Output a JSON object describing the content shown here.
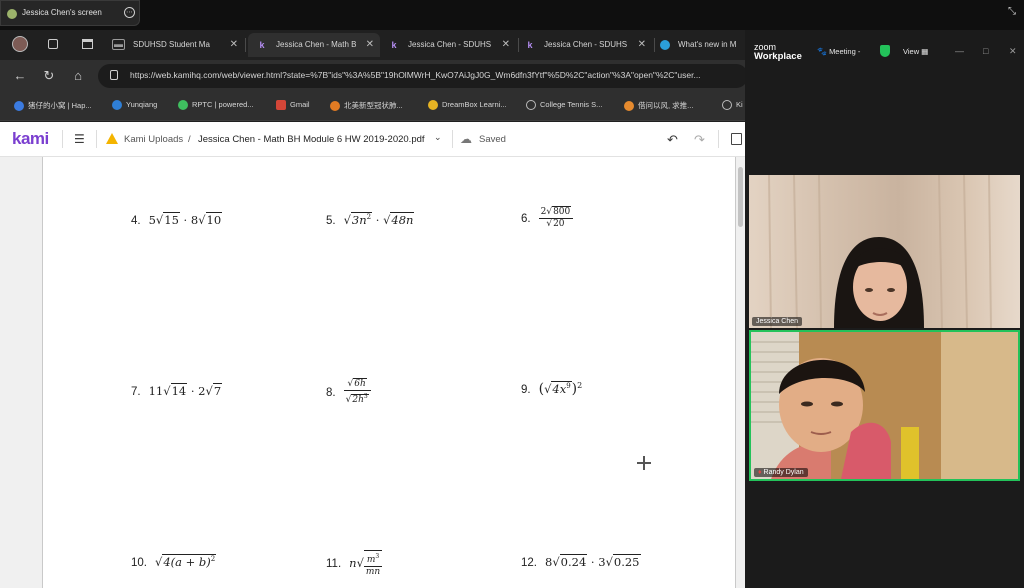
{
  "share_bar": {
    "label": "Jessica Chen's screen",
    "more_icon": "more-icon"
  },
  "browser": {
    "tabs": [
      {
        "label": "SDUHSD Student Ma",
        "icon": "document-icon",
        "color": "#7a7a7a"
      },
      {
        "label": "Jessica Chen - Math B",
        "icon": "kami-k-icon",
        "color": "#7b3fd0",
        "active": true
      },
      {
        "label": "Jessica Chen - SDUHS",
        "icon": "kami-k-icon",
        "color": "#7b3fd0"
      },
      {
        "label": "Jessica Chen - SDUHS",
        "icon": "kami-k-icon",
        "color": "#7b3fd0"
      },
      {
        "label": "What's new in M",
        "icon": "edge-icon",
        "color": "#2b9fd9"
      }
    ],
    "url": "https://web.kamihq.com/web/viewer.html?state=%7B\"ids\"%3A%5B\"19hOlMWrH_KwO7AiJgJ0G_Wm6dfn3fYtf\"%5D%2C\"action\"%3A\"open\"%2C\"user...",
    "favorites": [
      {
        "label": "猪仔的小窝 | Hap...",
        "color": "#3b7be0"
      },
      {
        "label": "Yunqiang",
        "color": "#2f7fd6"
      },
      {
        "label": "RPTC | powered...",
        "color": "#3fbf5f"
      },
      {
        "label": "Gmail",
        "color": "#d44638"
      },
      {
        "label": "北美新型冠状肺...",
        "color": "#e27b23"
      },
      {
        "label": "DreamBox Learni...",
        "color": "#e6b323"
      },
      {
        "label": "College Tennis S...",
        "color": "#bbbbbb"
      },
      {
        "label": "借问以风, 求推...",
        "color": "#e58a2e"
      },
      {
        "label": "Ki",
        "color": "#bbbbbb"
      }
    ]
  },
  "kami": {
    "logo": "kami",
    "breadcrumb_root": "Kami Uploads",
    "separator": "/",
    "doc_title": "Jessica Chen - Math BH Module 6 HW 2019-2020.pdf",
    "saved_label": "Saved"
  },
  "problems": {
    "p4": {
      "num": "4.",
      "a": "5",
      "r1": "15",
      "dot": "·",
      "b": "8",
      "r2": "10"
    },
    "p5": {
      "num": "5.",
      "r1": "3n",
      "e1": "2",
      "dot": "·",
      "r2": "48n"
    },
    "p6": {
      "num": "6.",
      "top_c": "2",
      "top_r": "800",
      "bot_r": "20"
    },
    "p7": {
      "num": "7.",
      "a": "11",
      "r1": "14",
      "dot": "·",
      "b": "2",
      "r2": "7"
    },
    "p8": {
      "num": "8.",
      "top_r": "6h",
      "bot_r": "2h",
      "bot_e": "3"
    },
    "p9": {
      "num": "9.",
      "open": "(",
      "r": "4x",
      "e": "9",
      "close": ")",
      "outer_e": "2"
    },
    "p10": {
      "num": "10.",
      "r": "4(a + b)",
      "e": "2"
    },
    "p11": {
      "num": "11.",
      "a": "n",
      "top": "m",
      "top_e": "3",
      "bot": "mn"
    },
    "p12": {
      "num": "12.",
      "a": "8",
      "r1": "0.24",
      "dot": "·",
      "b": "3",
      "r2": "0.25"
    }
  },
  "zoom": {
    "brand_top": "zoom",
    "brand_bottom": "Workplace",
    "meeting_label": "Meeting -",
    "view_label": "View",
    "participants": [
      {
        "name": "Jessica Chen"
      },
      {
        "name": "Randy Dylan"
      }
    ]
  }
}
